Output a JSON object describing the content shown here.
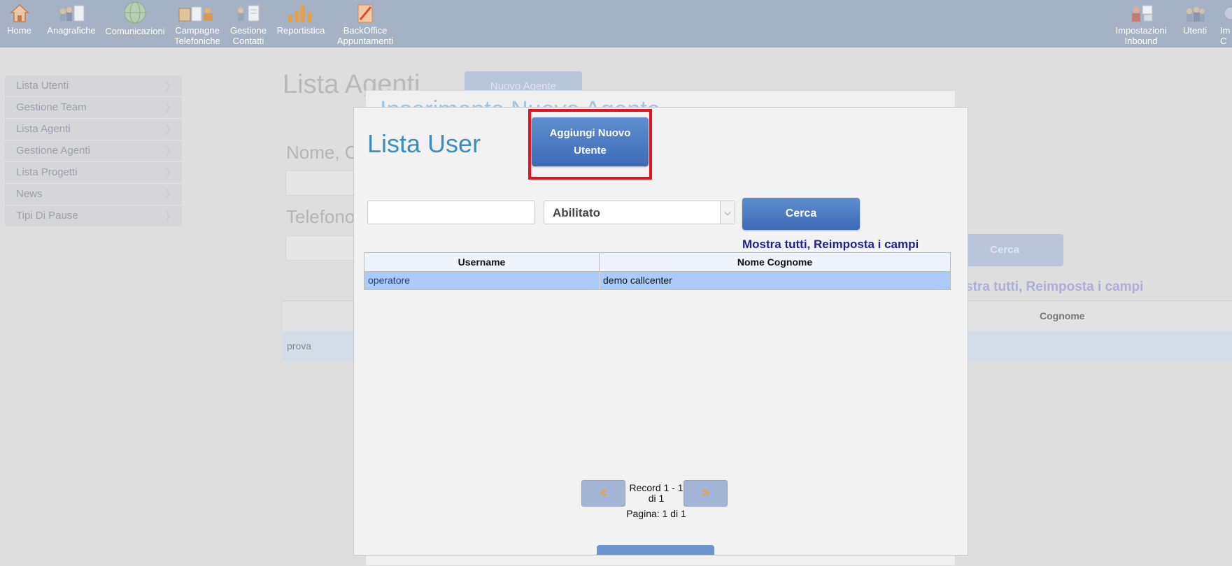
{
  "topnav": {
    "items": [
      {
        "label": "Home",
        "icon": "home-icon"
      },
      {
        "label": "Anagrafiche",
        "icon": "people-document-icon"
      },
      {
        "label": "Comunicazioni",
        "icon": "globe-icon"
      },
      {
        "label": "Campagne Telefoniche",
        "icon": "campaign-icon"
      },
      {
        "label": "Gestione Contatti",
        "icon": "contacts-icon"
      },
      {
        "label": "Reportistica",
        "icon": "bar-chart-icon"
      },
      {
        "label": "BackOffice Appuntamenti",
        "icon": "notepad-icon"
      }
    ],
    "right_items": [
      {
        "label": "Impostazioni Inbound",
        "icon": "inbound-settings-icon"
      },
      {
        "label": "Utenti",
        "icon": "users-icon"
      },
      {
        "label": "Im C",
        "icon": "settings-icon"
      }
    ]
  },
  "sidebar": {
    "items": [
      {
        "label": "Lista Utenti"
      },
      {
        "label": "Gestione Team"
      },
      {
        "label": "Lista Agenti"
      },
      {
        "label": "Gestione Agenti"
      },
      {
        "label": "Lista Progetti"
      },
      {
        "label": "News"
      },
      {
        "label": "Tipi Di Pause"
      }
    ]
  },
  "background": {
    "title": "Lista Agenti",
    "new_agent_button": "Nuovo Agente",
    "panel_title": "Inserimento Nuovo Agente",
    "label_nome": "Nome, C",
    "label_telefono": "Telefono",
    "cerca": "Cerca",
    "links": "stra tutti, Reimposta i campi",
    "col_cognome": "Cognome",
    "row_value": "prova"
  },
  "modal": {
    "title": "Lista User",
    "add_button": "Aggiungi Nuovo Utente",
    "search_placeholder": "",
    "status_select": "Abilitato",
    "cerca_button": "Cerca",
    "mostra_tutti": "Mostra tutti,",
    "reimposta": "Reimposta i campi",
    "table": {
      "headers": [
        "Username",
        "Nome Cognome"
      ],
      "rows": [
        [
          "operatore",
          "demo callcenter"
        ]
      ]
    },
    "pager": {
      "prev": "<",
      "next": ">",
      "record_text": "Record 1 - 1 di 1",
      "page_text": "Pagina: 1 di 1"
    }
  },
  "colors": {
    "topbar": "#a5b2c6",
    "modal_title": "#3b8dc0",
    "button": "#4a78c0",
    "highlight": "#e3141f",
    "selected_row": "#abcbf9",
    "link": "#1f1f8a"
  }
}
